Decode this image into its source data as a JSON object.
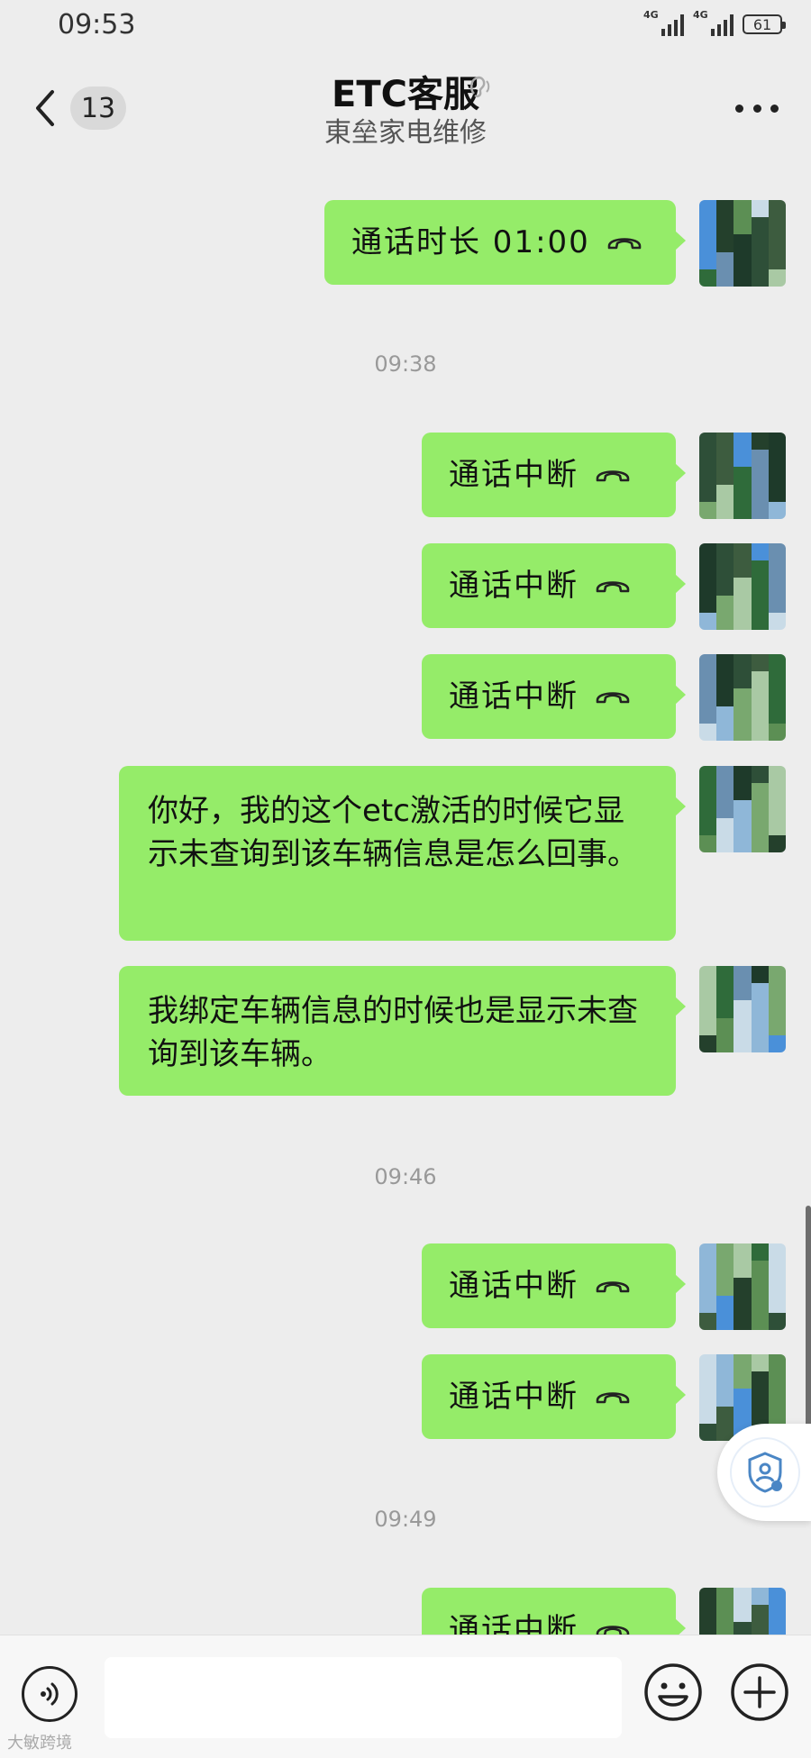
{
  "status_bar": {
    "time": "09:53",
    "signal_1": "4G",
    "signal_2": "4G",
    "battery": "61"
  },
  "header": {
    "unread_count": "13",
    "title": "ETC客服",
    "subtitle": "東垒家电维修"
  },
  "messages": [
    {
      "type": "call",
      "text": "通话时长 01:00"
    },
    {
      "type": "time",
      "text": "09:38"
    },
    {
      "type": "call",
      "text": "通话中断"
    },
    {
      "type": "call",
      "text": "通话中断"
    },
    {
      "type": "call",
      "text": "通话中断"
    },
    {
      "type": "text",
      "text": "你好，我的这个etc激活的时候它显示未查询到该车辆信息是怎么回事。"
    },
    {
      "type": "text",
      "text": "我绑定车辆信息的时候也是显示未查询到该车辆。"
    },
    {
      "type": "time",
      "text": "09:46"
    },
    {
      "type": "call",
      "text": "通话中断"
    },
    {
      "type": "call",
      "text": "通话中断"
    },
    {
      "type": "time",
      "text": "09:49"
    },
    {
      "type": "call",
      "text": "通话中断"
    }
  ],
  "colors": {
    "bubble": "#95ec69",
    "background": "#ededed",
    "input_bar": "#f7f7f7"
  },
  "icons": {
    "back": "chevron-left-icon",
    "ear": "ear-icon",
    "more": "more-dots-icon",
    "phone": "phone-hangup-icon",
    "voice": "voice-icon",
    "emoji": "emoji-icon",
    "plus": "plus-icon",
    "security": "shield-user-icon"
  },
  "input": {
    "value": "",
    "placeholder": ""
  },
  "watermark": "大敏跨境"
}
